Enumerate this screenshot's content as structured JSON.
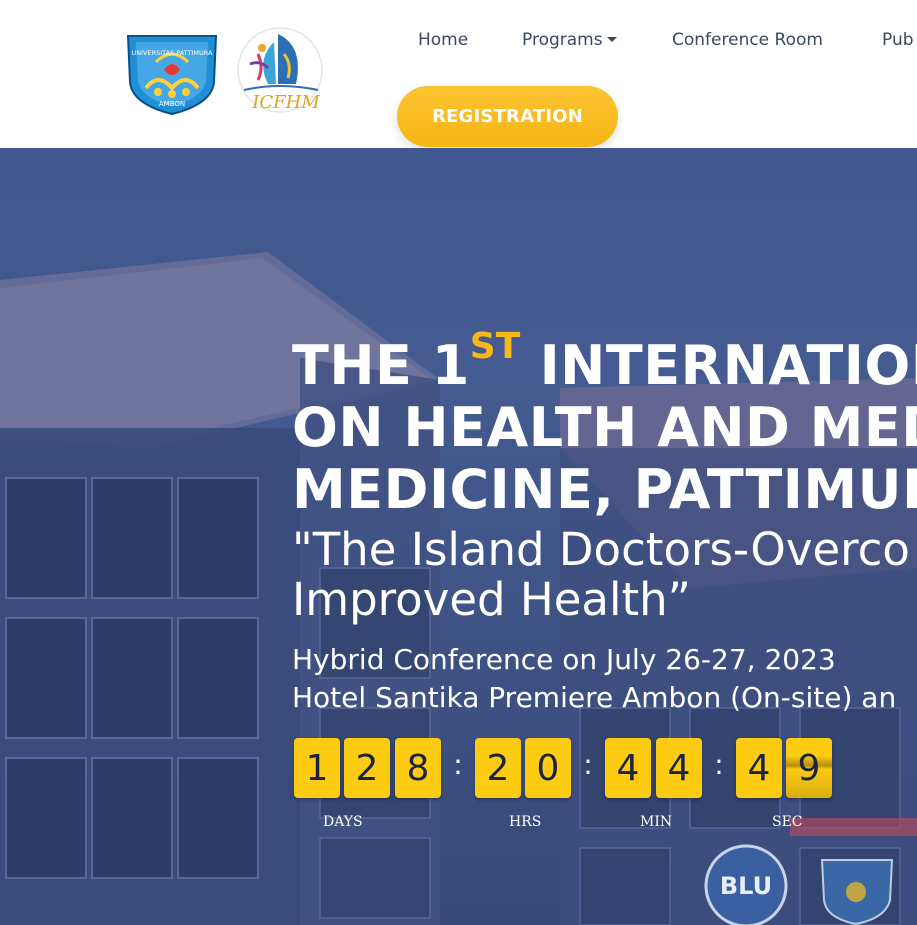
{
  "nav": {
    "home": "Home",
    "programs": "Programs",
    "conference_room": "Conference Room",
    "pub": "Pub"
  },
  "registration_button": "REGISTRATION",
  "hero": {
    "title_lines": [
      "THE 1",
      "ON HEALTH AND MED",
      "MEDICINE, PATTIMUR"
    ],
    "title_sup": "ST",
    "title_line1_rest": " INTERNATION",
    "theme_lines": [
      "\"The Island Doctors-Overco",
      "Improved Health”"
    ],
    "info_lines": [
      "Hybrid Conference on July 26-27, 2023",
      "Hotel Santika Premiere Ambon (On-site) an"
    ]
  },
  "countdown": {
    "days": [
      "1",
      "2",
      "8"
    ],
    "hours": [
      "2",
      "0"
    ],
    "minutes": [
      "4",
      "4"
    ],
    "seconds": [
      "4",
      "9"
    ],
    "separator": ":",
    "labels": {
      "days": "DAYS",
      "hours": "HRS",
      "minutes": "MIN",
      "seconds": "SEC"
    }
  },
  "logos": {
    "university_text": "UNIVERSITAS PATTIMURA",
    "university_city": "AMBON",
    "conference_logo_text": "ICFHM",
    "building_sign": "BLU"
  },
  "colors": {
    "accent": "#fbbf24",
    "nav_text": "#3c4a5f",
    "digit_bg": "#fdcb12",
    "hero_overlay": "#3f5790"
  }
}
